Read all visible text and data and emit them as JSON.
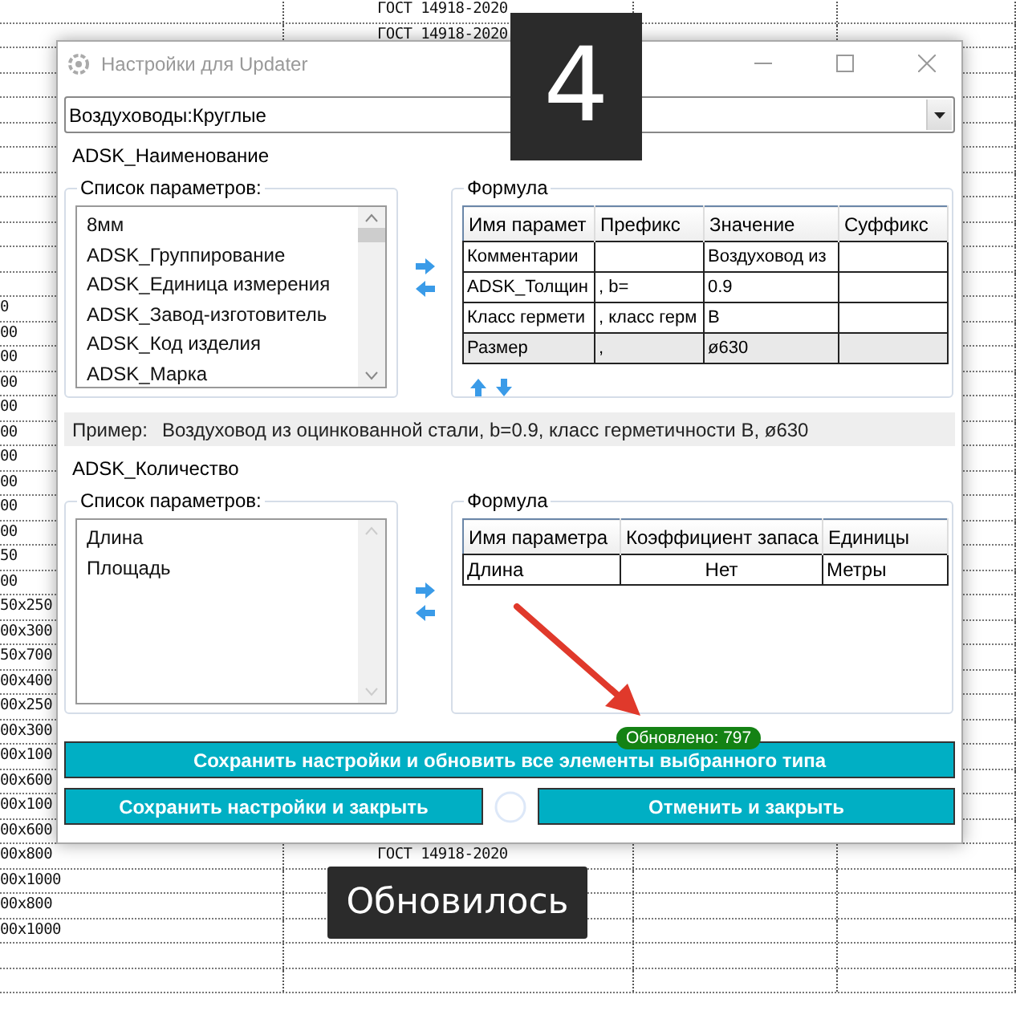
{
  "spreadsheet": {
    "rows": [
      {
        "column_2": "ГОСТ 14918-2020"
      },
      {
        "column_2": "ГОСТ 14918-2020"
      },
      {},
      {},
      {},
      {},
      {},
      {},
      {},
      {},
      {},
      {},
      {
        "column_1": "0"
      },
      {
        "column_1": "00"
      },
      {
        "column_1": "00"
      },
      {
        "column_1": "00"
      },
      {
        "column_1": "00"
      },
      {
        "column_1": "00"
      },
      {
        "column_1": "00"
      },
      {
        "column_1": "00"
      },
      {
        "column_1": "00"
      },
      {
        "column_1": "00"
      },
      {
        "column_1": "50"
      },
      {
        "column_1": "00"
      },
      {
        "column_1": "50x250"
      },
      {
        "column_1": "00x300"
      },
      {
        "column_1": "50x700"
      },
      {
        "column_1": "00x400"
      },
      {
        "column_1": "00x250"
      },
      {
        "column_1": "00x300"
      },
      {
        "column_1": "00x100"
      },
      {
        "column_1": "00x600"
      },
      {
        "column_1": "00x100"
      },
      {
        "column_1": "00x600"
      },
      {
        "column_1": "00x800",
        "column_2": "ГОСТ 14918-2020"
      },
      {
        "column_1": "00x1000"
      },
      {
        "column_1": "00x800"
      },
      {
        "column_1": "00x1000"
      },
      {},
      {}
    ]
  },
  "window": {
    "title": "Настройки для Updater",
    "type_selector": {
      "value": "Воздуховоды:Круглые"
    },
    "sections": [
      {
        "parameter": "ADSK_Наименование",
        "parameter_list": {
          "title": "Список параметров:",
          "scrollable": true,
          "items": [
            "8мм",
            "ADSK_Группирование",
            "ADSK_Единица измерения",
            "ADSK_Завод-изготовитель",
            "ADSK_Код изделия",
            "ADSK_Марка"
          ]
        },
        "formula": {
          "title": "Формула",
          "kind": "text",
          "reorder": true,
          "columns": [
            "Имя парамет",
            "Префикс",
            "Значение",
            "Суффикс"
          ],
          "rows": [
            {
              "selected": false,
              "name": "Комментарии",
              "value": "Воздуховод из"
            },
            {
              "selected": false,
              "name": "ADSK_Толщин",
              "prefix": ", b=",
              "value": "0.9"
            },
            {
              "selected": false,
              "name": "Класс гермети",
              "prefix": ", класс герм",
              "value": "В"
            },
            {
              "selected": true,
              "name": "Размер",
              "prefix": ",",
              "value": "ø630"
            }
          ]
        }
      },
      {
        "parameter": "ADSK_Количество",
        "parameter_list": {
          "title": "Список параметров:",
          "scrollable": false,
          "items": [
            "Длина",
            "Площадь"
          ]
        },
        "formula": {
          "title": "Формула",
          "kind": "quantity",
          "reorder": false,
          "columns": [
            "Имя параметра",
            "Коэффициент запаса",
            "Единицы"
          ],
          "rows": [
            {
              "selected": false,
              "name": "Длина",
              "factor": "Нет",
              "units": "Метры"
            }
          ]
        }
      }
    ],
    "example": {
      "label": "Пример:",
      "text": "Воздуховод из оцинкованной стали, b=0.9, класс герметичности В, ø630"
    },
    "update_button": {
      "label": "Сохранить настройки и обновить все элементы выбранного типа",
      "badge": "Обновлено: 797"
    },
    "save_button": {
      "label": "Сохранить настройки и закрыть"
    },
    "cancel_button": {
      "label": "Отменить и закрыть"
    }
  },
  "step_badge": "4",
  "caption": "Обновилось"
}
